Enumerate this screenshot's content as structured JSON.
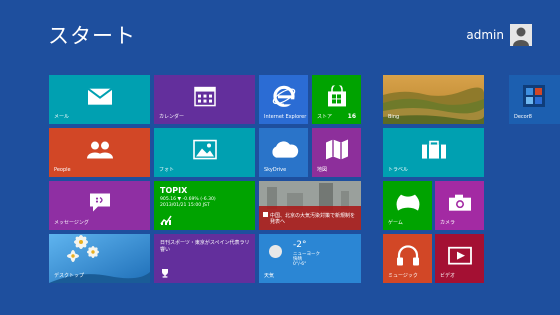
{
  "start_title": "スタート",
  "user": {
    "name": "admin"
  },
  "tiles": {
    "mail": {
      "label": "メール",
      "color": "#00a0b1"
    },
    "calendar": {
      "label": "カレンダー",
      "color": "#632f9c"
    },
    "ie": {
      "label": "Internet Explorer",
      "color": "#2b6cd4"
    },
    "store": {
      "label": "ストア",
      "badge": "16",
      "color": "#00a300"
    },
    "bing": {
      "label": "Bing"
    },
    "people": {
      "label": "People",
      "color": "#d24726"
    },
    "photos": {
      "label": "フォト",
      "color": "#00a0b1"
    },
    "skydrive": {
      "label": "SkyDrive",
      "color": "#2a74c9"
    },
    "maps": {
      "label": "地図",
      "color": "#8d2f9b"
    },
    "travel": {
      "label": "トラベル",
      "color": "#00a0b1"
    },
    "messaging": {
      "label": "メッセージング",
      "color": "#8f2fa3"
    },
    "finance": {
      "name": "TOPIX",
      "line1": "905.16 ▼ -0.69% (-6.30)",
      "line2": "2013/01/21 15:00 JST",
      "color": "#00a300"
    },
    "news": {
      "headline": "中国、北京の大気汚染対策で新規制を発表へ"
    },
    "games": {
      "label": "ゲーム",
      "color": "#00a300"
    },
    "camera": {
      "label": "カメラ",
      "color": "#a32aa3"
    },
    "desktop": {
      "label": "デスクトップ"
    },
    "sports": {
      "headline": "日刊スポーツ・東京がスペイン代表ラリ 響い",
      "color": "#632f9c"
    },
    "weather": {
      "temp": "-2°",
      "location": "ニューヨーク",
      "condition": "快晴",
      "range": "0°/-6°",
      "label": "天気",
      "color": "#2b86d4"
    },
    "music": {
      "label": "ミュージック",
      "color": "#d24726"
    },
    "video": {
      "label": "ビデオ",
      "color": "#a41033"
    },
    "decor": {
      "label": "Decor8",
      "color": "#1c5fb0"
    }
  }
}
